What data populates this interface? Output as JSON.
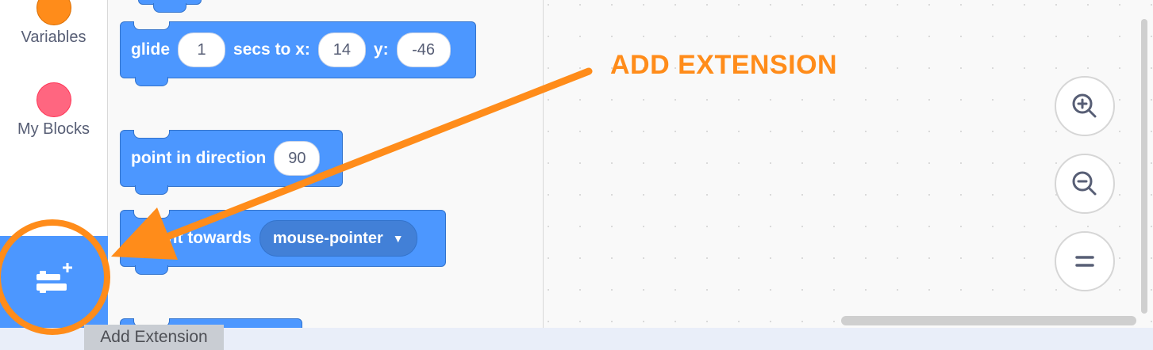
{
  "categories": [
    {
      "label": "Variables",
      "color": "#ff8c1a"
    },
    {
      "label": "My Blocks",
      "color": "#ff6680"
    }
  ],
  "blocks": {
    "glide": {
      "word1": "glide",
      "secs": "1",
      "word2": "secs to x:",
      "x": "14",
      "word3": "y:",
      "y": "-46"
    },
    "point_direction": {
      "label": "point in direction",
      "value": "90"
    },
    "point_towards": {
      "label": "oint towards",
      "value": "mouse-pointer"
    }
  },
  "add_extension": {
    "tooltip": "Add Extension",
    "annotation": "ADD EXTENSION"
  },
  "colors": {
    "motion_blue": "#4c97ff",
    "annotation_orange": "#ff8c1a"
  },
  "icons": [
    "zoom-in-icon",
    "zoom-out-icon",
    "zoom-reset-icon",
    "add-extension-icon"
  ]
}
